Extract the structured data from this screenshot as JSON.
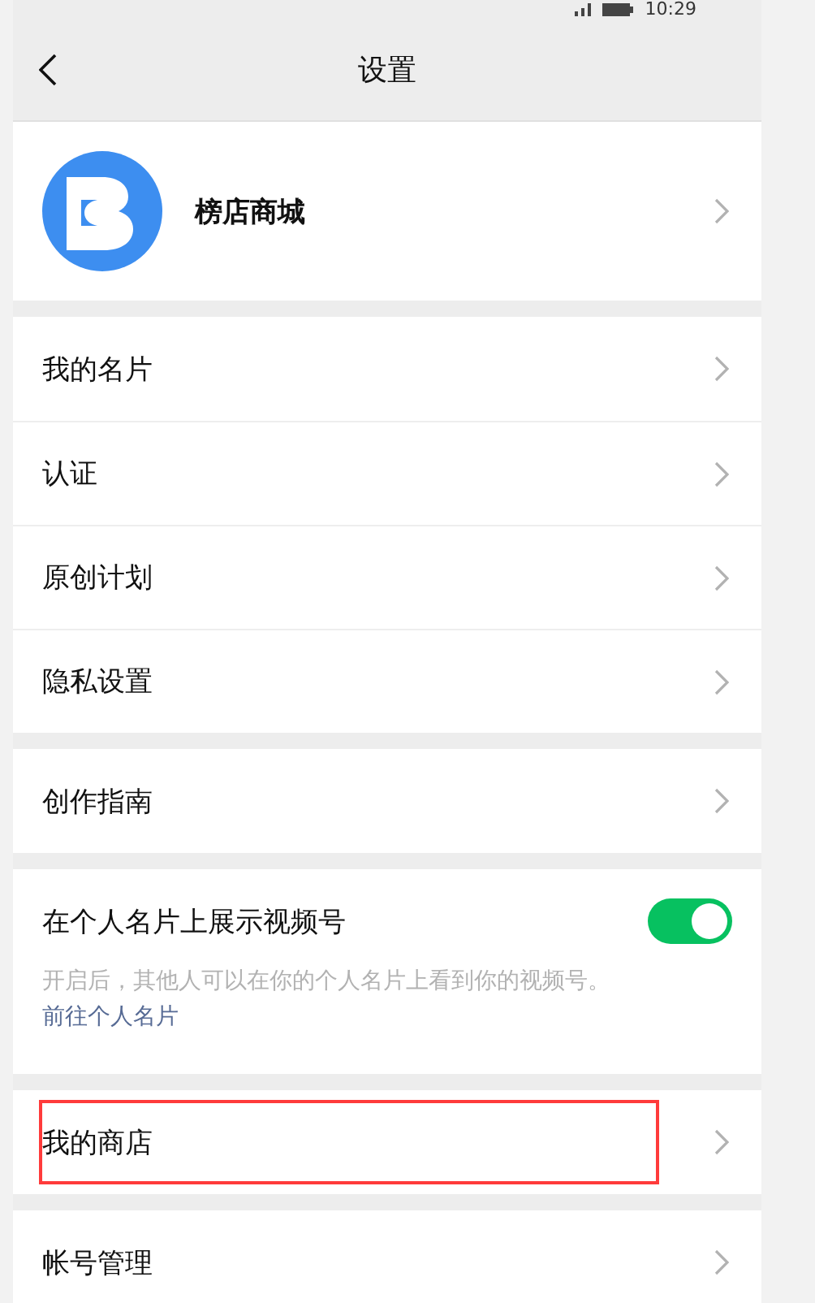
{
  "status_bar": {
    "time": "10:29"
  },
  "nav": {
    "title": "设置"
  },
  "sections": [
    {
      "items": [
        {
          "kind": "profile",
          "label": "榜店商城"
        }
      ]
    },
    {
      "items": [
        {
          "kind": "link",
          "label": "我的名片",
          "highlighted": false
        },
        {
          "kind": "link",
          "label": "认证",
          "highlighted": false
        },
        {
          "kind": "link",
          "label": "原创计划",
          "highlighted": false
        },
        {
          "kind": "link",
          "label": "隐私设置",
          "highlighted": false
        }
      ]
    },
    {
      "items": [
        {
          "kind": "link",
          "label": "创作指南",
          "highlighted": false
        }
      ]
    },
    {
      "items": [
        {
          "kind": "toggle",
          "label": "在个人名片上展示视频号",
          "on": true,
          "description": "开启后，其他人可以在你的个人名片上看到你的视频号。",
          "link": "前往个人名片"
        }
      ]
    },
    {
      "items": [
        {
          "kind": "link",
          "label": "我的商店",
          "highlighted": true
        }
      ]
    },
    {
      "items": [
        {
          "kind": "link",
          "label": "帐号管理",
          "highlighted": false
        }
      ]
    }
  ]
}
